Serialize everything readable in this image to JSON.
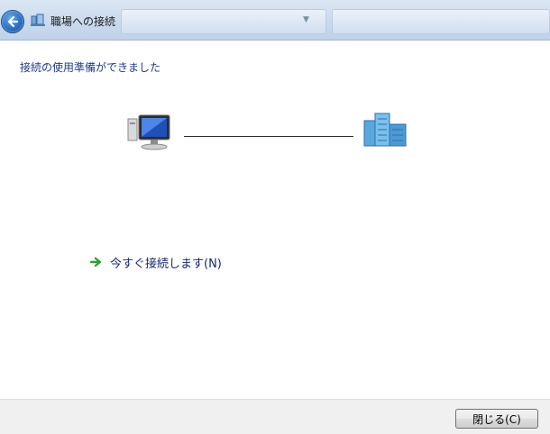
{
  "window": {
    "title": "職場への接続"
  },
  "icons": {
    "back": "back-arrow-icon",
    "title": "network-place-icon",
    "computer": "computer-icon",
    "workplace": "workplace-building-icon",
    "connect_arrow": "green-arrow-icon"
  },
  "main": {
    "status_heading": "接続の使用準備ができました",
    "connect_link": "今すぐ接続します(N)"
  },
  "footer": {
    "close_label": "閉じる(C)"
  },
  "colors": {
    "heading": "#1e3a8a",
    "link": "#13287a",
    "arrow": "#2fa12f",
    "back_button": "#2a6fc4"
  }
}
